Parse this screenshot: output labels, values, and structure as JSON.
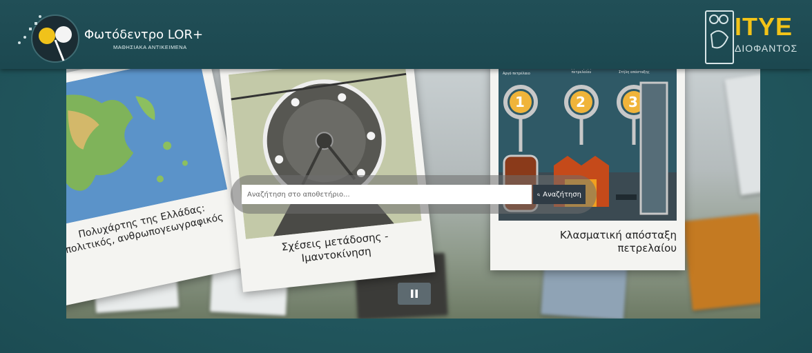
{
  "header": {
    "site_title": "Φωτόδεντρο LOR+",
    "site_subtitle": "ΜΑΘΗΣΙΑΚΑ ΑΝΤΙΚΕΙΜΕΝΑ",
    "partner_name": "ITYE",
    "partner_subtitle": "ΔΙΟΦΑΝΤΟΣ"
  },
  "carousel": {
    "cards": [
      {
        "label_line1": "Πολυχάρτης της Ελλάδας:",
        "label_line2": "πολιτικός, ανθρωπογεωγραφικός"
      },
      {
        "label_line1": "Σχέσεις μετάδοσης -",
        "label_line2": "Ιμαντοκίνηση"
      },
      {
        "label_line1": "Κλασματική απόσταξη",
        "label_line2": "πετρελαίου",
        "stage_labels": [
          "Αργό πετρέλαιο",
          "Θέρμανση αργού πετρελαίου",
          "Στήλη απόσταξης"
        ],
        "stage_numbers": [
          "1",
          "2",
          "3"
        ]
      }
    ]
  },
  "search": {
    "placeholder": "Αναζήτηση στο αποθετήριο...",
    "button_label": "Αναζήτηση"
  },
  "colors": {
    "background": "#235960",
    "header": "#1f4d55",
    "accent_yellow": "#f2c318",
    "search_button": "#2f3b45"
  }
}
